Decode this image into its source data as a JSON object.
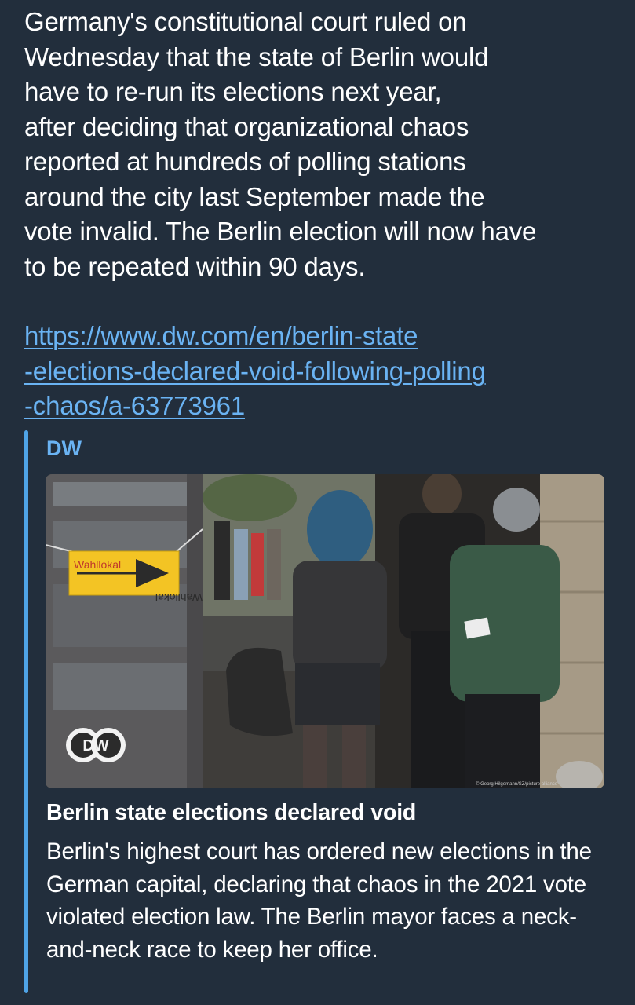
{
  "message": {
    "text": "Germany's constitutional court ruled on\nWednesday that the state of Berlin would\nhave to re-run its elections next year,\nafter deciding that organizational chaos\nreported at hundreds of polling stations\naround the city last September made the\nvote invalid. The Berlin election will now have\nto be repeated within 90 days.",
    "link": "https://www.dw.com/en/berlin-state\n-elections-declared-void-following-polling\n-chaos/a-63773961"
  },
  "preview": {
    "site_name": "DW",
    "image": {
      "sign_text": "Wahllokal",
      "sign_mirror_text": "Wahllokal",
      "logo_text": "DW",
      "credit": "© Georg Hilgemann/SZ/picture alliance"
    },
    "title": "Berlin state elections declared void",
    "description": "Berlin's highest court has ordered new elections in the German capital, declaring that chaos in the 2021 vote violated election law. The Berlin mayor faces a neck-and-neck race to keep her office."
  },
  "colors": {
    "background": "#222e3c",
    "link": "#6ab3f3",
    "accent_bar": "#4fa3e6",
    "sign": "#f3c424"
  }
}
